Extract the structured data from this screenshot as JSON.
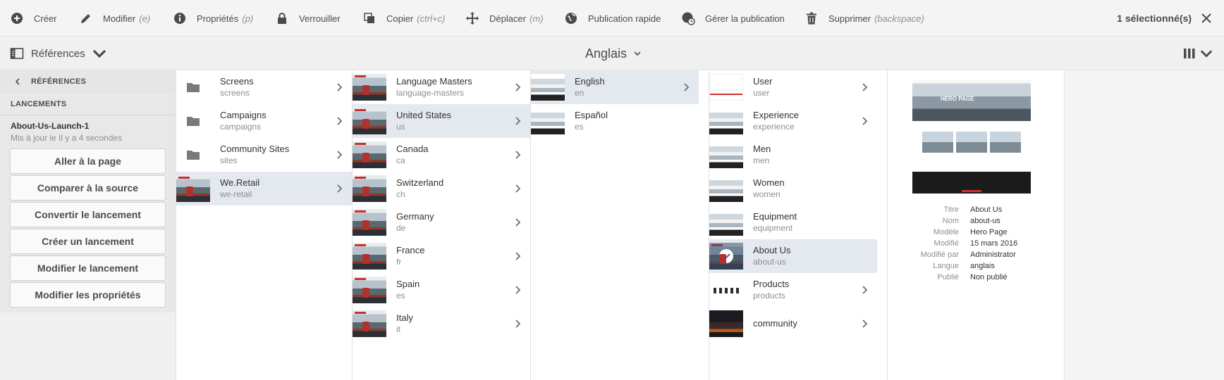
{
  "toolbar": {
    "create": "Créer",
    "edit": "Modifier",
    "edit_hint": "(e)",
    "properties": "Propriétés",
    "properties_hint": "(p)",
    "lock": "Verrouiller",
    "copy": "Copier",
    "copy_hint": "(ctrl+c)",
    "move": "Déplacer",
    "move_hint": "(m)",
    "quick_publish": "Publication rapide",
    "manage_publication": "Gérer la publication",
    "delete": "Supprimer",
    "delete_hint": "(backspace)",
    "selection_count": "1 sélectionné(s)"
  },
  "subbar": {
    "rail_label": "Références",
    "language_label": "Anglais"
  },
  "rail": {
    "back_label": "RÉFÉRENCES",
    "section_label": "LANCEMENTS",
    "launch_name": "About-Us-Launch-1",
    "launch_meta": "Mis à jour le Il y a 4 secondes",
    "buttons": [
      "Aller à la page",
      "Comparer à la source",
      "Convertir le lancement",
      "Créer un lancement",
      "Modifier le lancement",
      "Modifier les propriétés"
    ]
  },
  "columns": [
    {
      "items": [
        {
          "title": "Screens",
          "sub": "screens",
          "icon": "folder-icon"
        },
        {
          "title": "Campaigns",
          "sub": "campaigns",
          "icon": "folder-icon"
        },
        {
          "title": "Community Sites",
          "sub": "sites",
          "icon": "folder-icon"
        },
        {
          "title": "We.Retail",
          "sub": "we-retail",
          "icon": "site-thumbnail"
        }
      ]
    },
    {
      "items": [
        {
          "title": "Language Masters",
          "sub": "language-masters"
        },
        {
          "title": "United States",
          "sub": "us"
        },
        {
          "title": "Canada",
          "sub": "ca"
        },
        {
          "title": "Switzerland",
          "sub": "ch"
        },
        {
          "title": "Germany",
          "sub": "de"
        },
        {
          "title": "France",
          "sub": "fr"
        },
        {
          "title": "Spain",
          "sub": "es"
        },
        {
          "title": "Italy",
          "sub": "it"
        }
      ]
    },
    {
      "items": [
        {
          "title": "English",
          "sub": "en"
        },
        {
          "title": "Español",
          "sub": "es"
        }
      ]
    },
    {
      "items": [
        {
          "title": "User",
          "sub": "user"
        },
        {
          "title": "Experience",
          "sub": "experience"
        },
        {
          "title": "Men",
          "sub": "men"
        },
        {
          "title": "Women",
          "sub": "women"
        },
        {
          "title": "Equipment",
          "sub": "equipment"
        },
        {
          "title": "About Us",
          "sub": "about-us"
        },
        {
          "title": "Products",
          "sub": "products"
        },
        {
          "title": "community",
          "sub": ""
        }
      ]
    }
  ],
  "preview": {
    "hero_title": "HERO PAGE",
    "meta": [
      {
        "key": "Titre",
        "value": "About Us"
      },
      {
        "key": "Nom",
        "value": "about-us"
      },
      {
        "key": "Modèle",
        "value": "Hero Page"
      },
      {
        "key": "Modifié",
        "value": "15 mars 2016"
      },
      {
        "key": "Modifié par",
        "value": "Administrator"
      },
      {
        "key": "Langue",
        "value": "anglais"
      },
      {
        "key": "Publié",
        "value": "Non publié"
      }
    ]
  },
  "colors": {
    "active_row": "#e4e8ef",
    "toolbar_bg": "#f4f4f4",
    "accent_red": "#c9302c"
  }
}
